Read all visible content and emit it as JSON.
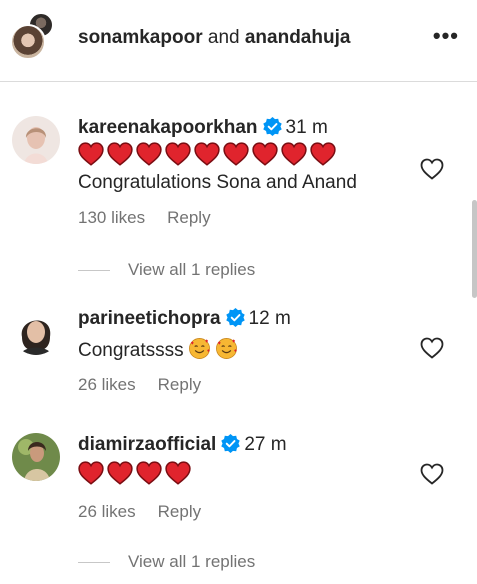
{
  "header": {
    "user1": "sonamkapoor",
    "joiner": " and ",
    "user2": "anandahuja",
    "more_icon": "•••"
  },
  "comments": [
    {
      "username": "kareenakapoorkhan",
      "time": "31 m",
      "hearts": 9,
      "text": "Congratulations Sona and Anand",
      "likes": "130 likes",
      "reply": "Reply",
      "view_replies": "View all 1 replies"
    },
    {
      "username": "parineetichopra",
      "time": "12 m",
      "text": "Congratssss",
      "emojis": [
        "smiling-face-with-hearts",
        "smiling-face-with-hearts"
      ],
      "likes": "26 likes",
      "reply": "Reply"
    },
    {
      "username": "diamirzaofficial",
      "time": "27 m",
      "hearts": 4,
      "likes": "26 likes",
      "reply": "Reply",
      "view_replies": "View all 1 replies"
    }
  ],
  "colors": {
    "verified": "#0095f6",
    "heart": "#e0242d",
    "meta": "#737373"
  }
}
